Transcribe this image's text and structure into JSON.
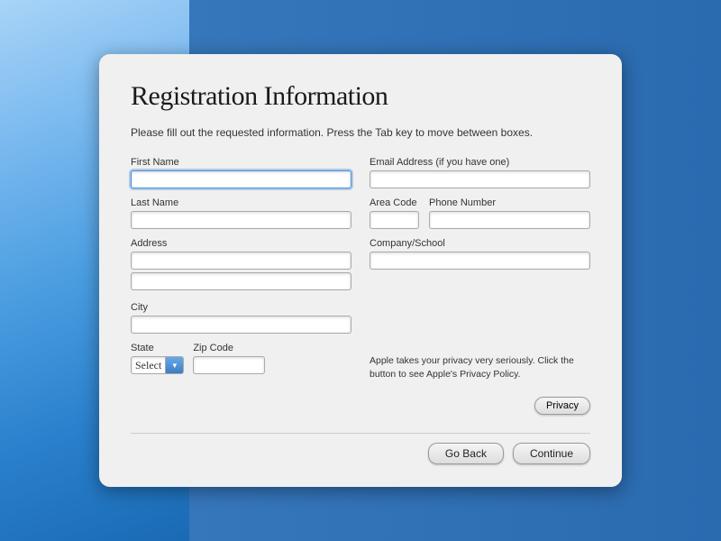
{
  "page": {
    "title": "Registration Information",
    "subtitle": "Please fill out the requested information. Press the Tab key to move between boxes.",
    "background_color": "#3a7bbf"
  },
  "form": {
    "left": {
      "first_name": {
        "label": "First Name",
        "value": "",
        "placeholder": ""
      },
      "last_name": {
        "label": "Last Name",
        "value": "",
        "placeholder": ""
      },
      "address": {
        "label": "Address",
        "line1": "",
        "line2": ""
      },
      "city": {
        "label": "City",
        "value": ""
      },
      "state": {
        "label": "State",
        "value": "Select"
      },
      "zip_code": {
        "label": "Zip Code",
        "value": ""
      }
    },
    "right": {
      "email": {
        "label": "Email Address (if you have one)",
        "value": "",
        "placeholder": ""
      },
      "area_code": {
        "label": "Area Code",
        "value": ""
      },
      "phone_number": {
        "label": "Phone Number",
        "value": ""
      },
      "company_school": {
        "label": "Company/School",
        "value": ""
      }
    }
  },
  "privacy": {
    "text": "Apple takes your privacy very seriously. Click the button to see Apple's Privacy Policy.",
    "button_label": "Privacy"
  },
  "buttons": {
    "go_back": "Go Back",
    "continue": "Continue"
  }
}
